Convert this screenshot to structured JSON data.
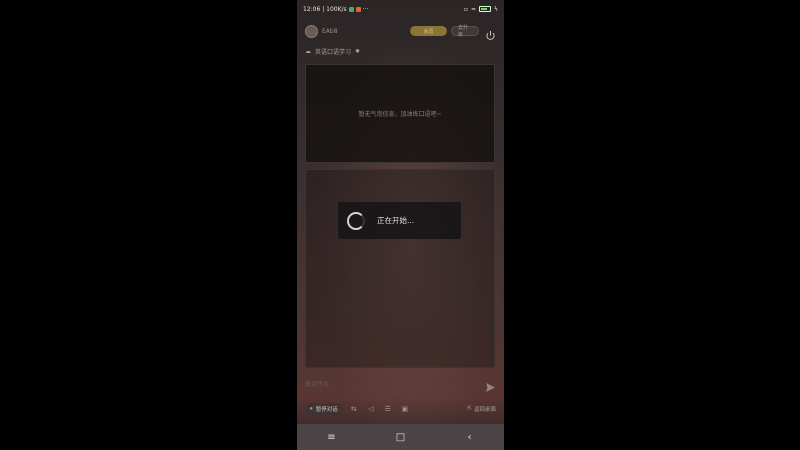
{
  "status_bar": {
    "time_and_speed": "12:06 | 100K/s",
    "more": "···",
    "battery_level": 0.8
  },
  "header": {
    "username": "EAb8",
    "gold_button": "会员",
    "secondary_button": "去升级"
  },
  "subheader": {
    "title": "英语口语学习"
  },
  "panel": {
    "placeholder_text": "暂无气泡信息，加油练口语吧~"
  },
  "loading": {
    "text": "正在开始..."
  },
  "input": {
    "placeholder": "说点什么"
  },
  "toolbar": {
    "pause_label": "暂停对话",
    "back_to_desktop_label": "返回桌面"
  },
  "navbar": {
    "menu": "≡",
    "home": "□",
    "back": "‹"
  },
  "colors": {
    "accent_gold": "#8a7436",
    "battery_green": "#6fdc4f"
  }
}
